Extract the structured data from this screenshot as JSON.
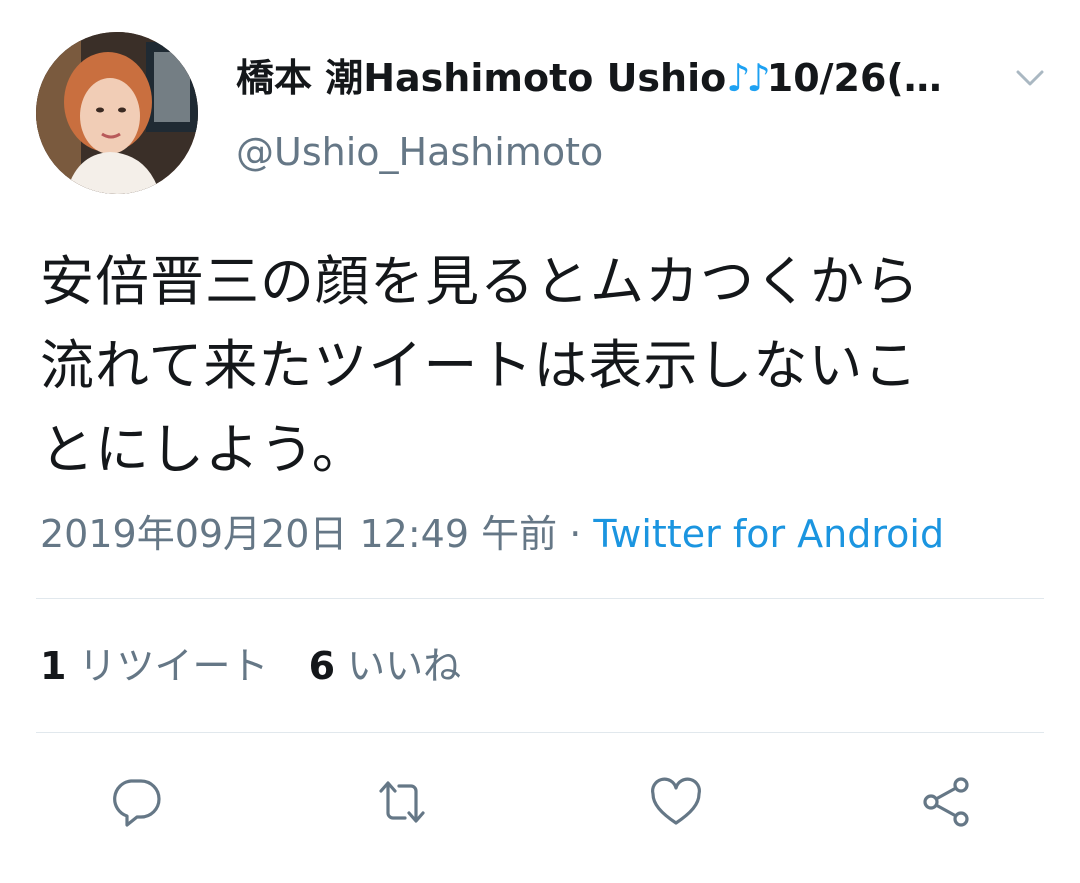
{
  "user": {
    "display_name": "橋本 潮Hashimoto Ushio",
    "name_emoji": "♪♪",
    "name_suffix": "10/26(…",
    "handle": "@Ushio_Hashimoto"
  },
  "tweet": {
    "text": "安倍晋三の顔を見るとムカつくから\n流れて来たツイートは表示しないこ\nとにしよう。",
    "timestamp": "2019年09月20日 12:49 午前",
    "separator": "·",
    "source": "Twitter for Android"
  },
  "stats": {
    "retweet_count": "1",
    "retweet_label": "リツイート",
    "like_count": "6",
    "like_label": "いいね"
  },
  "actions": {
    "reply_icon": "reply-icon",
    "retweet_icon": "retweet-icon",
    "like_icon": "heart-icon",
    "share_icon": "share-icon"
  },
  "colors": {
    "text": "#14171a",
    "muted": "#657786",
    "accent": "#1da1f2",
    "link": "#1b95e0",
    "divider": "#e1e8ed"
  }
}
